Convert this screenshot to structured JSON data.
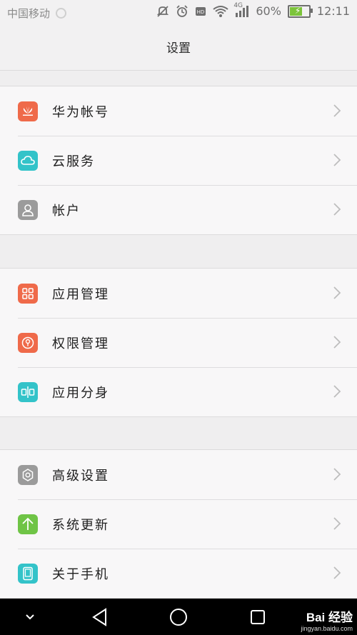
{
  "status_bar": {
    "carrier": "中国移动",
    "network": "4G",
    "battery": "60%",
    "battery_level": 0.6,
    "time": "12:11"
  },
  "title": "设置",
  "groups": [
    {
      "items": [
        {
          "label": "华为帐号",
          "icon": "huawei-icon",
          "color": "#ef6a4a"
        },
        {
          "label": "云服务",
          "icon": "cloud-icon",
          "color": "#33c3c9"
        },
        {
          "label": "帐户",
          "icon": "account-icon",
          "color": "#9b9b9b"
        }
      ]
    },
    {
      "items": [
        {
          "label": "应用管理",
          "icon": "app-manager-icon",
          "color": "#ef6a4a"
        },
        {
          "label": "权限管理",
          "icon": "permission-icon",
          "color": "#ef6a4a"
        },
        {
          "label": "应用分身",
          "icon": "app-twin-icon",
          "color": "#33c3c9"
        }
      ]
    },
    {
      "items": [
        {
          "label": "高级设置",
          "icon": "advanced-settings-icon",
          "color": "#9b9b9b"
        },
        {
          "label": "系统更新",
          "icon": "system-update-icon",
          "color": "#6fc446"
        },
        {
          "label": "关于手机",
          "icon": "about-phone-icon",
          "color": "#33c3c9"
        }
      ]
    }
  ],
  "watermark": {
    "main": "Bai 经验",
    "sub": "jingyan.baidu.com"
  }
}
